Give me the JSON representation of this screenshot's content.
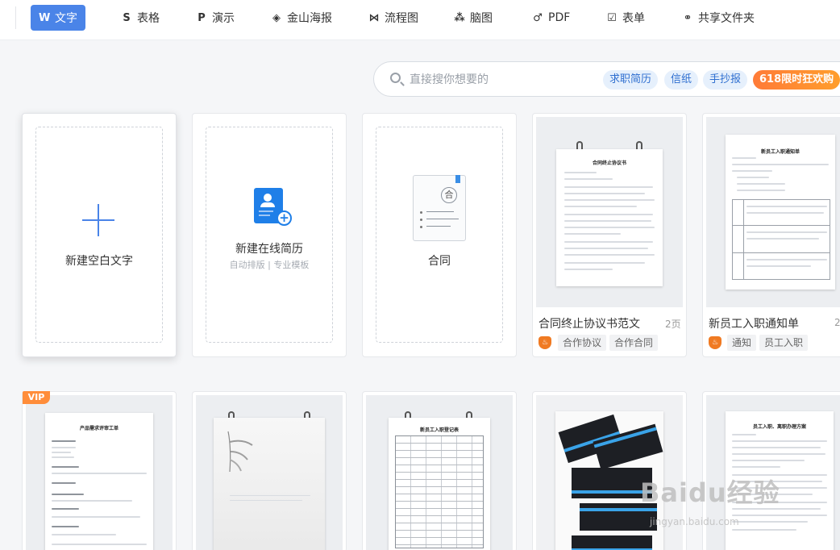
{
  "tabs": [
    {
      "icon": "W",
      "label": "文字"
    },
    {
      "icon": "S",
      "label": "表格"
    },
    {
      "icon": "P",
      "label": "演示"
    },
    {
      "icon": "◈",
      "label": "金山海报"
    },
    {
      "icon": "⋈",
      "label": "流程图"
    },
    {
      "icon": "⁂",
      "label": "脑图"
    },
    {
      "icon": "♂",
      "label": "PDF"
    },
    {
      "icon": "☑",
      "label": "表单"
    },
    {
      "icon": "⚭",
      "label": "共享文件夹"
    }
  ],
  "search": {
    "placeholder": "直接搜你想要的",
    "chips": [
      "求职简历",
      "信纸",
      "手抄报"
    ],
    "promo": "618限时狂欢购"
  },
  "create": {
    "blank": "新建空白文字",
    "resume": "新建在线简历",
    "resume_sub": "自动排版 | 专业模板",
    "contract": "合同",
    "contract_icon": "合"
  },
  "templates": [
    {
      "title": "合同终止协议书范文",
      "pages": "2页",
      "tags": [
        "合作协议",
        "合作合同"
      ],
      "doc_heading": "合同终止协议书"
    },
    {
      "title": "新员工入职通知单",
      "pages": "2",
      "tags": [
        "通知",
        "员工入职"
      ],
      "doc_heading": "新员工入职通知单"
    }
  ],
  "row2": {
    "vip": "VIP",
    "doc1_title": "产品需求评审工单",
    "doc3_title": "新员工入职登记表",
    "doc5_title": "员工入职、离职办理方案"
  },
  "watermark": {
    "text": "Baidu经验",
    "sub": "jingyan.baidu.com"
  },
  "colors": {
    "accent": "#4a84e8",
    "promo": "#ff8d3a",
    "chip_bg": "#e6f0fc"
  }
}
